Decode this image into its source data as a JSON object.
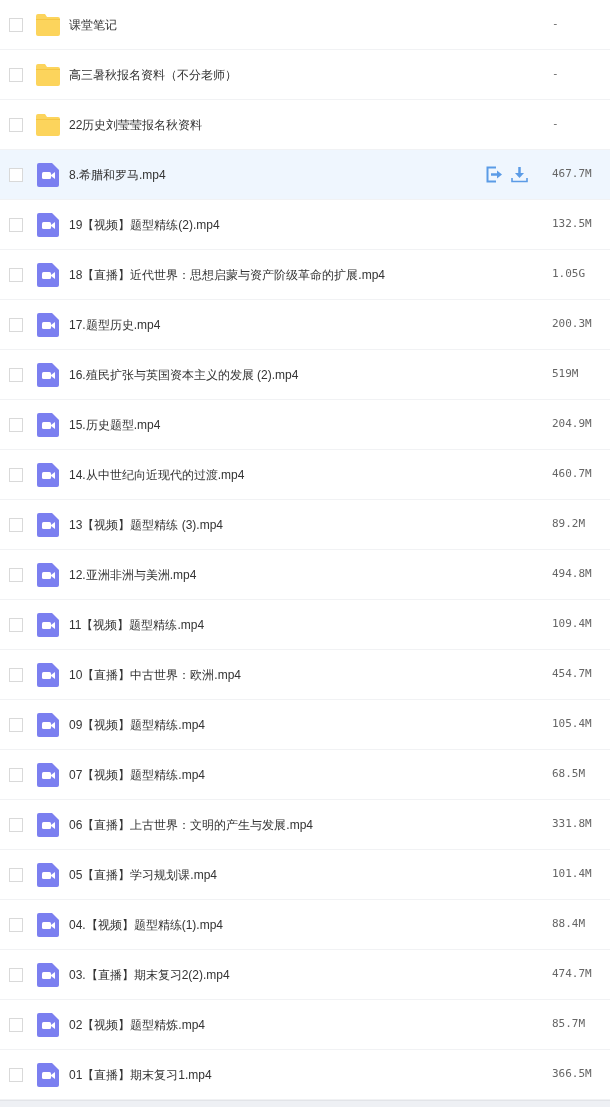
{
  "files": [
    {
      "kind": "folder",
      "name": "课堂笔记",
      "size": "-",
      "hovered": false,
      "checked": false
    },
    {
      "kind": "folder",
      "name": "高三暑秋报名资料（不分老师）",
      "size": "-",
      "hovered": false,
      "checked": false
    },
    {
      "kind": "folder",
      "name": "22历史刘莹莹报名秋资料",
      "size": "-",
      "hovered": false,
      "checked": false
    },
    {
      "kind": "video",
      "name": "8.希腊和罗马.mp4",
      "size": "467.7M",
      "hovered": true,
      "checked": false
    },
    {
      "kind": "video",
      "name": "19【视频】题型精练(2).mp4",
      "size": "132.5M",
      "hovered": false,
      "checked": false
    },
    {
      "kind": "video",
      "name": "18【直播】近代世界：思想启蒙与资产阶级革命的扩展.mp4",
      "size": "1.05G",
      "hovered": false,
      "checked": false
    },
    {
      "kind": "video",
      "name": "17.题型历史.mp4",
      "size": "200.3M",
      "hovered": false,
      "checked": false
    },
    {
      "kind": "video",
      "name": "16.殖民扩张与英国资本主义的发展 (2).mp4",
      "size": "519M",
      "hovered": false,
      "checked": false
    },
    {
      "kind": "video",
      "name": "15.历史题型.mp4",
      "size": "204.9M",
      "hovered": false,
      "checked": false
    },
    {
      "kind": "video",
      "name": "14.从中世纪向近现代的过渡.mp4",
      "size": "460.7M",
      "hovered": false,
      "checked": false
    },
    {
      "kind": "video",
      "name": "13【视频】题型精练 (3).mp4",
      "size": "89.2M",
      "hovered": false,
      "checked": false
    },
    {
      "kind": "video",
      "name": "12.亚洲非洲与美洲.mp4",
      "size": "494.8M",
      "hovered": false,
      "checked": false
    },
    {
      "kind": "video",
      "name": "11【视频】题型精练.mp4",
      "size": "109.4M",
      "hovered": false,
      "checked": false
    },
    {
      "kind": "video",
      "name": "10【直播】中古世界：欧洲.mp4",
      "size": "454.7M",
      "hovered": false,
      "checked": false
    },
    {
      "kind": "video",
      "name": "09【视频】题型精练.mp4",
      "size": "105.4M",
      "hovered": false,
      "checked": false
    },
    {
      "kind": "video",
      "name": "07【视频】题型精练.mp4",
      "size": "68.5M",
      "hovered": false,
      "checked": false
    },
    {
      "kind": "video",
      "name": "06【直播】上古世界：文明的产生与发展.mp4",
      "size": "331.8M",
      "hovered": false,
      "checked": false
    },
    {
      "kind": "video",
      "name": "05【直播】学习规划课.mp4",
      "size": "101.4M",
      "hovered": false,
      "checked": false
    },
    {
      "kind": "video",
      "name": "04.【视频】题型精练(1).mp4",
      "size": "88.4M",
      "hovered": false,
      "checked": false
    },
    {
      "kind": "video",
      "name": "03.【直播】期末复习2(2).mp4",
      "size": "474.7M",
      "hovered": false,
      "checked": false
    },
    {
      "kind": "video",
      "name": "02【视频】题型精炼.mp4",
      "size": "85.7M",
      "hovered": false,
      "checked": false
    },
    {
      "kind": "video",
      "name": "01【直播】期末复习1.mp4",
      "size": "366.5M",
      "hovered": false,
      "checked": false
    }
  ]
}
